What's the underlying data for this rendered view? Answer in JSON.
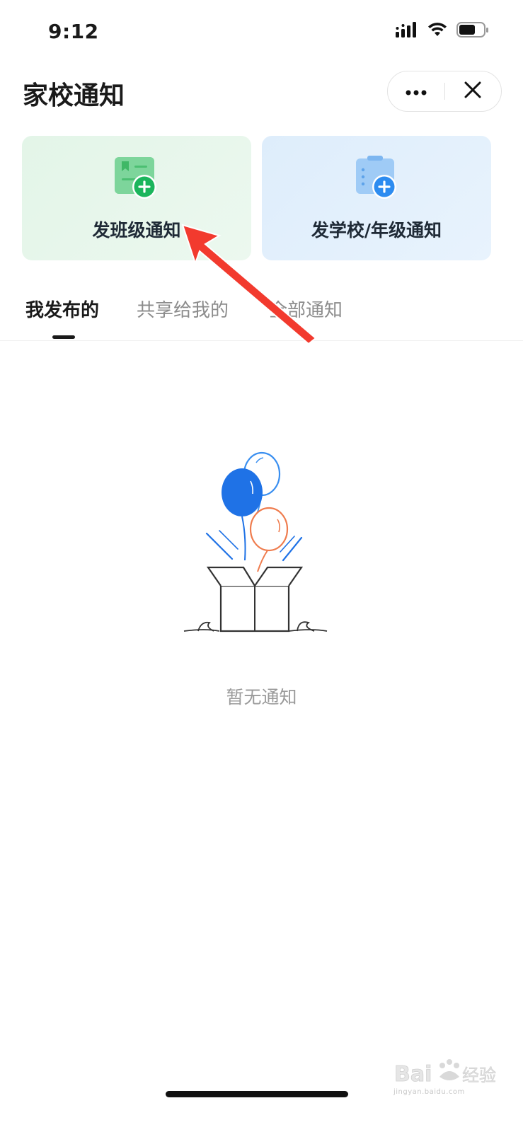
{
  "status_bar": {
    "time": "9:12",
    "icons": [
      "signal-icon",
      "wifi-icon",
      "battery-icon"
    ]
  },
  "header": {
    "title": "家校通知",
    "more_icon": "more-dots-icon",
    "close_icon": "close-icon"
  },
  "actions": {
    "class_notice": {
      "label": "发班级通知",
      "icon": "class-notice-add-icon",
      "color": "#1bb55c"
    },
    "school_notice": {
      "label": "发学校/年级通知",
      "icon": "school-notice-add-icon",
      "color": "#2d8cf0"
    }
  },
  "tabs": [
    {
      "label": "我发布的",
      "active": true
    },
    {
      "label": "共享给我的",
      "active": false
    },
    {
      "label": "全部通知",
      "active": false
    }
  ],
  "empty_state": {
    "text": "暂无通知",
    "illustration": "balloons-gift-box-illustration"
  },
  "annotation": {
    "icon": "red-arrow-pointer",
    "color": "#f23a2e"
  },
  "watermark": {
    "logo": "Bai经验",
    "url": "jingyan.baidu.com"
  }
}
